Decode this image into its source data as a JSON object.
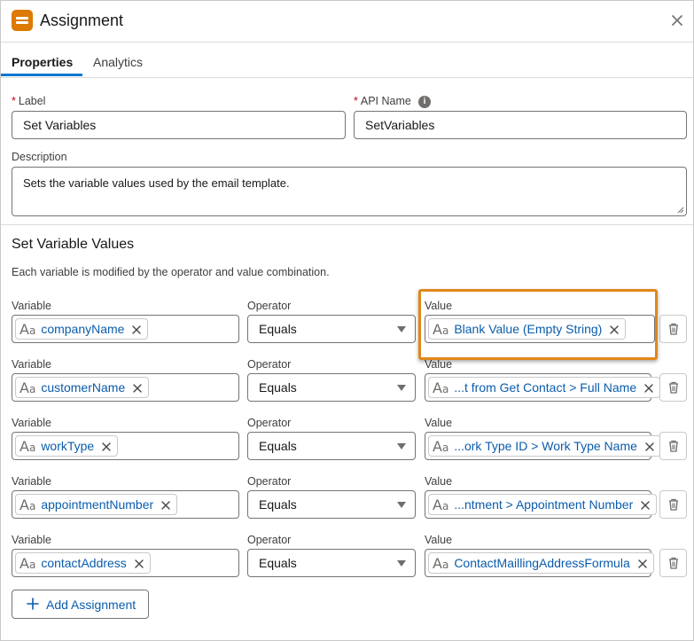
{
  "header": {
    "title": "Assignment"
  },
  "tabs": [
    {
      "label": "Properties"
    },
    {
      "label": "Analytics"
    }
  ],
  "form": {
    "label_caption": "Label",
    "label_value": "Set Variables",
    "api_name_caption": "API Name",
    "api_name_value": "SetVariables",
    "description_caption": "Description",
    "description_value": "Sets the variable values used by the email template."
  },
  "section": {
    "title": "Set Variable Values",
    "description": "Each variable is modified by the operator and value combination."
  },
  "column_labels": {
    "variable": "Variable",
    "operator": "Operator",
    "value": "Value"
  },
  "rows": [
    {
      "variable": "companyName",
      "operator": "Equals",
      "value": "Blank Value (Empty String)"
    },
    {
      "variable": "customerName",
      "operator": "Equals",
      "value": "...t from Get Contact > Full Name"
    },
    {
      "variable": "workType",
      "operator": "Equals",
      "value": "...ork Type ID > Work Type Name"
    },
    {
      "variable": "appointmentNumber",
      "operator": "Equals",
      "value": "...ntment > Appointment Number"
    },
    {
      "variable": "contactAddress",
      "operator": "Equals",
      "value": "ContactMaillingAddressFormula"
    }
  ],
  "actions": {
    "add_assignment": "Add Assignment"
  },
  "colors": {
    "accent": "#0176d3",
    "icon_orange": "#dd7a01",
    "highlight": "#e0871b",
    "link": "#0b5cab"
  }
}
